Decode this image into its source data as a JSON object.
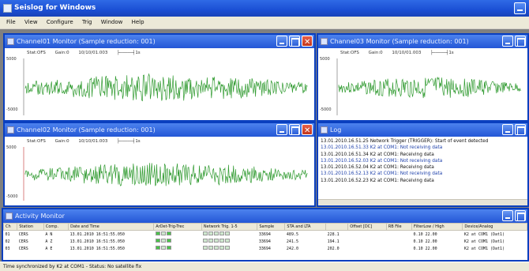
{
  "app": {
    "title": "Seislog for Windows"
  },
  "menu": [
    "File",
    "View",
    "Configure",
    "Trig",
    "Window",
    "Help"
  ],
  "windows": {
    "ch01": {
      "title": "Channel01 Monitor (Sample reduction: 001)",
      "hdr_status": "Stat:OFS",
      "hdr_gain": "Gain:0",
      "hdr_time": "10/10/01.003",
      "hdr_scale": "1s",
      "ytop": "5000",
      "ybot": "-5000"
    },
    "ch03": {
      "title": "Channel03 Monitor (Sample reduction: 001)",
      "hdr_status": "Stat:OFS",
      "hdr_gain": "Gain:0",
      "hdr_time": "10/10/01.003",
      "hdr_scale": "1s",
      "ytop": "5000",
      "ybot": "-5000"
    },
    "ch02": {
      "title": "Channel02 Monitor (Sample reduction: 001)",
      "hdr_status": "Stat:OFS",
      "hdr_gain": "Gain:0",
      "hdr_time": "10/10/01.003",
      "hdr_scale": "1s",
      "ytop": "5000",
      "ybot": "-5000"
    },
    "log": {
      "title": "Log",
      "lines": [
        {
          "text": "13.01.2010.16.51.25 Network Trigger (TRIGGER): Start of event detected",
          "color": "black"
        },
        {
          "text": "13.01.2010.16.51.33 K2 at COM1: Not receiving data",
          "color": "blue"
        },
        {
          "text": "13.01.2010.16.51.34 K2 at COM1: Receiving data",
          "color": "black"
        },
        {
          "text": "13.01.2010.16.52.03 K2 at COM1: Not receiving data",
          "color": "blue"
        },
        {
          "text": "13.01.2010.16.52.04 K2 at COM1: Receiving data",
          "color": "black"
        },
        {
          "text": "13.01.2010.16.52.13 K2 at COM1: Not receiving data",
          "color": "blue"
        },
        {
          "text": "13.01.2010.16.52.23 K2 at COM1: Receiving data",
          "color": "black"
        }
      ]
    },
    "activity": {
      "title": "Activity Monitor",
      "columns": [
        "Ch",
        "Station",
        "Comp.",
        "Date and Time",
        "ArDet-Trig-Trec",
        "Network Trig. 1-5",
        "Sample",
        "STA and LTA",
        "",
        "Offset [DC]",
        "RB File",
        "FilterLow / High",
        "Device/Analog"
      ],
      "rows": [
        {
          "ch": "01",
          "station": "CERS",
          "comp": "A  N",
          "datetime": "13.01.2010 16:51:55.050",
          "sample": "33694",
          "sta": "489.5",
          "lta": "228.1",
          "offset": "",
          "rbfile": "",
          "filter": "0.10  22.00",
          "device": "K2 at COM1 (Dat1)"
        },
        {
          "ch": "02",
          "station": "CERS",
          "comp": "A  Z",
          "datetime": "13.01.2010 16:51:55.050",
          "sample": "33694",
          "sta": "241.5",
          "lta": "194.1",
          "offset": "",
          "rbfile": "",
          "filter": "0.10  22.00",
          "device": "K2 at COM1 (Dat1)"
        },
        {
          "ch": "03",
          "station": "CERS",
          "comp": "A  E",
          "datetime": "13.01.2010 16:51:55.050",
          "sample": "33694",
          "sta": "242.0",
          "lta": "202.0",
          "offset": "",
          "rbfile": "",
          "filter": "0.10  22.00",
          "device": "K2 at COM1 (Dat1)"
        }
      ]
    }
  },
  "status": {
    "text": "Time synchronized by K2 at COM1  -  Status: No satellite fix"
  },
  "colors": {
    "title_blue": "#2457d6",
    "trace_green": "#2f9a2f",
    "mdi_bg": "#808080"
  },
  "icons": {
    "window_close": "close-icon",
    "window_max": "maximize-icon",
    "window_min": "minimize-icon"
  }
}
